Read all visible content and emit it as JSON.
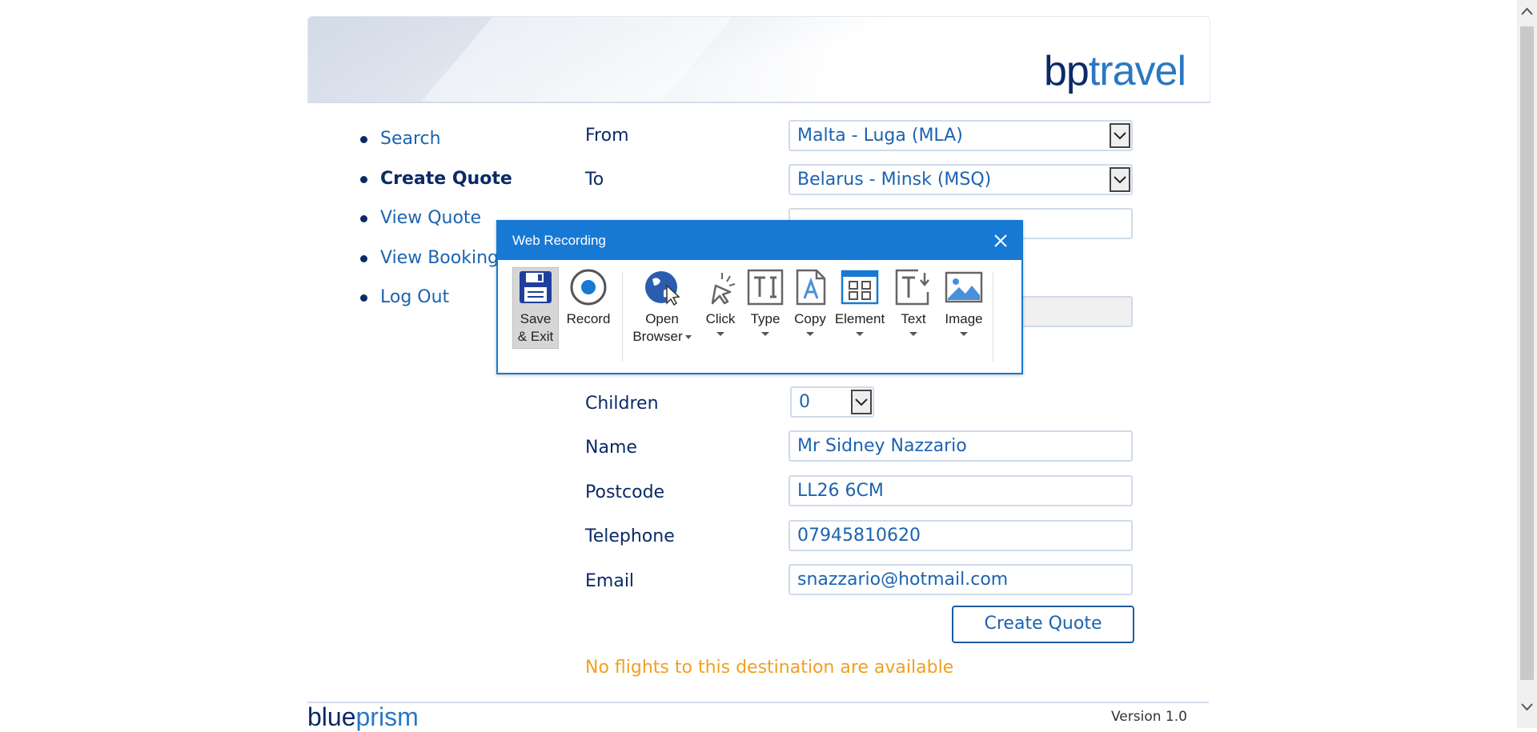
{
  "brand": {
    "part1": "bp",
    "part2": "travel"
  },
  "nav": {
    "items": [
      {
        "label": "Search",
        "active": false
      },
      {
        "label": "Create Quote",
        "active": true
      },
      {
        "label": "View Quote",
        "active": false
      },
      {
        "label": "View Booking",
        "active": false
      },
      {
        "label": "Log Out",
        "active": false
      }
    ]
  },
  "form": {
    "from_label": "From",
    "from_value": "Malta - Luga (MLA)",
    "to_label": "To",
    "to_value": "Belarus - Minsk (MSQ)",
    "children_label": "Children",
    "children_value": "0",
    "name_label": "Name",
    "name_value": "Mr Sidney Nazzario",
    "postcode_label": "Postcode",
    "postcode_value": "LL26 6CM",
    "telephone_label": "Telephone",
    "telephone_value": "07945810620",
    "email_label": "Email",
    "email_value": "snazzario@hotmail.com",
    "submit_label": "Create Quote",
    "message": "No flights to this destination are available"
  },
  "footer": {
    "logo_part1": "blue",
    "logo_part2": "prism",
    "version": "Version 1.0"
  },
  "dialog": {
    "title": "Web Recording",
    "tools": {
      "save": "Save & Exit",
      "save_line1": "Save",
      "save_line2": "& Exit",
      "record": "Record",
      "open_line1": "Open",
      "open_line2": "Browser",
      "click": "Click",
      "type": "Type",
      "copy": "Copy",
      "element": "Element",
      "text": "Text",
      "image": "Image"
    }
  },
  "colors": {
    "accent": "#1779d3",
    "brand_dark": "#0b2a66",
    "link": "#1c63b0",
    "warning": "#f0a020"
  }
}
